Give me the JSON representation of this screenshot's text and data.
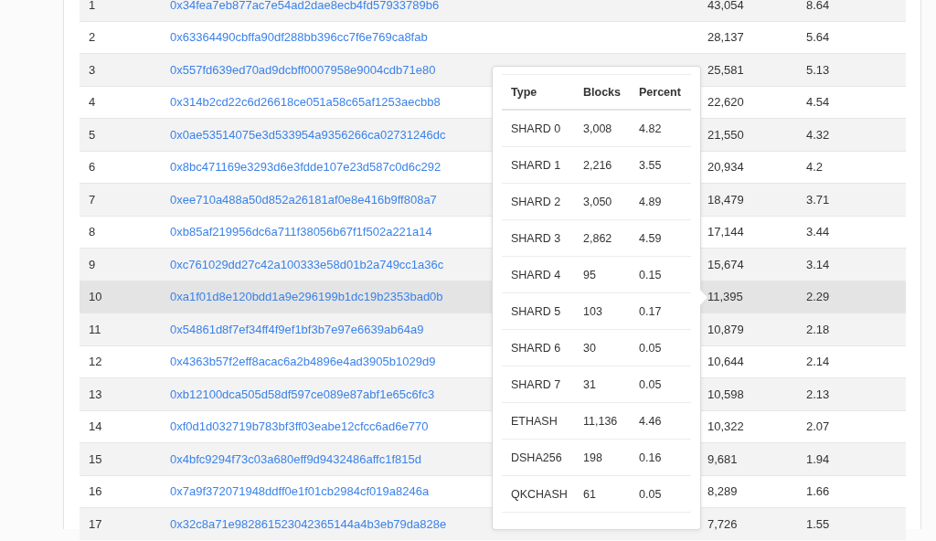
{
  "table": {
    "rows": [
      {
        "rank": "1",
        "address": "0x34fea7eb877ac7e54ad2dae8ecb4fd57933789b6",
        "blocks": "43,054",
        "percent": "8.64",
        "highlighted": false
      },
      {
        "rank": "2",
        "address": "0x63364490cbffa90df288bb396cc7f6e769ca8fab",
        "blocks": "28,137",
        "percent": "5.64",
        "highlighted": false
      },
      {
        "rank": "3",
        "address": "0x557fd639ed70ad9dcbff0007958e9004cdb71e80",
        "blocks": "25,581",
        "percent": "5.13",
        "highlighted": false
      },
      {
        "rank": "4",
        "address": "0x314b2cd22c6d26618ce051a58c65af1253aecbb8",
        "blocks": "22,620",
        "percent": "4.54",
        "highlighted": false
      },
      {
        "rank": "5",
        "address": "0x0ae53514075e3d533954a9356266ca02731246dc",
        "blocks": "21,550",
        "percent": "4.32",
        "highlighted": false
      },
      {
        "rank": "6",
        "address": "0x8bc471169e3293d6e3fdde107e23d587c0d6c292",
        "blocks": "20,934",
        "percent": "4.2",
        "highlighted": false
      },
      {
        "rank": "7",
        "address": "0xee710a488a50d852a26181af0e8e416b9ff808a7",
        "blocks": "18,479",
        "percent": "3.71",
        "highlighted": false
      },
      {
        "rank": "8",
        "address": "0xb85af219956dc6a711f38056b67f1f502a221a14",
        "blocks": "17,144",
        "percent": "3.44",
        "highlighted": false
      },
      {
        "rank": "9",
        "address": "0xc761029dd27c42a100333e58d01b2a749cc1a36c",
        "blocks": "15,674",
        "percent": "3.14",
        "highlighted": false
      },
      {
        "rank": "10",
        "address": "0xa1f01d8e120bdd1a9e296199b1dc19b2353bad0b",
        "blocks": "11,395",
        "percent": "2.29",
        "highlighted": true
      },
      {
        "rank": "11",
        "address": "0x54861d8f7ef34ff4f9ef1bf3b7e97e6639ab64a9",
        "blocks": "10,879",
        "percent": "2.18",
        "highlighted": false
      },
      {
        "rank": "12",
        "address": "0x4363b57f2eff8acac6a2b4896e4ad3905b1029d9",
        "blocks": "10,644",
        "percent": "2.14",
        "highlighted": false
      },
      {
        "rank": "13",
        "address": "0xb12100dca505d58df597ce089e87abf1e65c6fc3",
        "blocks": "10,598",
        "percent": "2.13",
        "highlighted": false
      },
      {
        "rank": "14",
        "address": "0xf0d1d032719b783bf3ff03eabe12cfcc6ad6e770",
        "blocks": "10,322",
        "percent": "2.07",
        "highlighted": false
      },
      {
        "rank": "15",
        "address": "0x4bfc9294f73c03a680eff9d9432486affc1f815d",
        "blocks": "9,681",
        "percent": "1.94",
        "highlighted": false
      },
      {
        "rank": "16",
        "address": "0x7a9f372071948ddff0e1f01cb2984cf019a8246a",
        "blocks": "8,289",
        "percent": "1.66",
        "highlighted": false
      },
      {
        "rank": "17",
        "address": "0x32c8a71e982861523042365144a4b3eb79da828e",
        "blocks": "7,726",
        "percent": "1.55",
        "highlighted": false
      }
    ]
  },
  "popover": {
    "columns": [
      "Type",
      "Blocks",
      "Percent"
    ],
    "rows": [
      {
        "type": "SHARD 0",
        "blocks": "3,008",
        "percent": "4.82"
      },
      {
        "type": "SHARD 1",
        "blocks": "2,216",
        "percent": "3.55"
      },
      {
        "type": "SHARD 2",
        "blocks": "3,050",
        "percent": "4.89"
      },
      {
        "type": "SHARD 3",
        "blocks": "2,862",
        "percent": "4.59"
      },
      {
        "type": "SHARD 4",
        "blocks": "95",
        "percent": "0.15"
      },
      {
        "type": "SHARD 5",
        "blocks": "103",
        "percent": "0.17"
      },
      {
        "type": "SHARD 6",
        "blocks": "30",
        "percent": "0.05"
      },
      {
        "type": "SHARD 7",
        "blocks": "31",
        "percent": "0.05"
      },
      {
        "type": "ETHASH",
        "blocks": "11,136",
        "percent": "4.46"
      },
      {
        "type": "DSHA256",
        "blocks": "198",
        "percent": "0.16"
      },
      {
        "type": "QKCHASH",
        "blocks": "61",
        "percent": "0.05"
      }
    ]
  }
}
